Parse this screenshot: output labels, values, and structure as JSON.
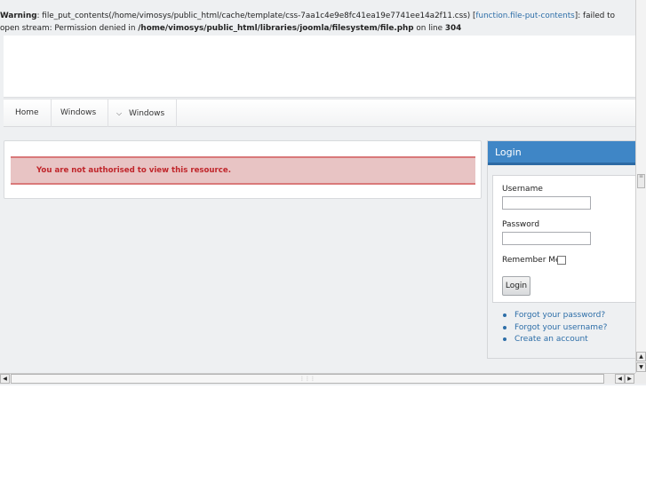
{
  "warning": {
    "prefix": "Warning",
    "text1": ": file_put_contents(/home/vimosys/public_html/cache/template/css-7aa1c4e9e8fc41ea19e7741ee14a2f11.css) [",
    "link": "function.file-put-contents",
    "text2": "]: failed to open stream: Permission denied in ",
    "path": "/home/vimosys/public_html/libraries/joomla/filesystem/file.php",
    "text3": " on line ",
    "line": "304"
  },
  "nav": {
    "items": [
      {
        "label": "Home"
      },
      {
        "label": "Windows"
      },
      {
        "label": "Windows",
        "icon": "chevron-down-icon"
      }
    ]
  },
  "content": {
    "alert_text": "You are not authorised to view this resource."
  },
  "login": {
    "title": "Login",
    "username_label": "Username",
    "username_value": "",
    "password_label": "Password",
    "password_value": "",
    "remember_label": "Remember Me",
    "remember_checked": false,
    "button_label": "Login",
    "links": [
      "Forgot your password?",
      "Forgot your username?",
      "Create an account"
    ]
  },
  "colors": {
    "accent": "#3f86c6",
    "alert_bg": "#e8c4c4",
    "alert_text": "#c0262b",
    "link": "#2d6ea8"
  }
}
